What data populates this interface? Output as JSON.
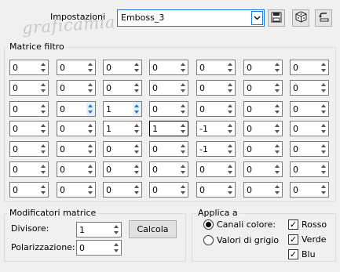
{
  "watermark": "graficamia",
  "header": {
    "impostazioni_label": "Impostazioni",
    "preset_value": "Emboss_3",
    "icons": [
      "save-icon",
      "randomize-dice-icon",
      "reset-icon"
    ]
  },
  "matrix": {
    "title": "Matrice filtro",
    "rows": [
      [
        "0",
        "0",
        "0",
        "0",
        "0",
        "0",
        "0"
      ],
      [
        "0",
        "0",
        "0",
        "0",
        "0",
        "0",
        "0"
      ],
      [
        "0",
        "0",
        "1",
        "0",
        "0",
        "0",
        "0"
      ],
      [
        "0",
        "0",
        "1",
        "1",
        "-1",
        "0",
        "0"
      ],
      [
        "0",
        "0",
        "0",
        "0",
        "-1",
        "0",
        "0"
      ],
      [
        "0",
        "0",
        "0",
        "0",
        "0",
        "0",
        "0"
      ],
      [
        "0",
        "0",
        "0",
        "0",
        "0",
        "0",
        "0"
      ]
    ]
  },
  "modifiers": {
    "title": "Modificatori matrice",
    "divisore_label": "Divisore:",
    "divisore_value": "1",
    "calcola_label": "Calcola",
    "polarizzazione_label": "Polarizzazione:",
    "polarizzazione_value": "0"
  },
  "apply": {
    "title": "Applica a",
    "canali_label": "Canali colore:",
    "valori_label": "Valori di grigio",
    "selected": "canali",
    "rosso_label": "Rosso",
    "verde_label": "Verde",
    "blu_label": "Blu",
    "rosso_checked": true,
    "verde_checked": true,
    "blu_checked": true
  }
}
